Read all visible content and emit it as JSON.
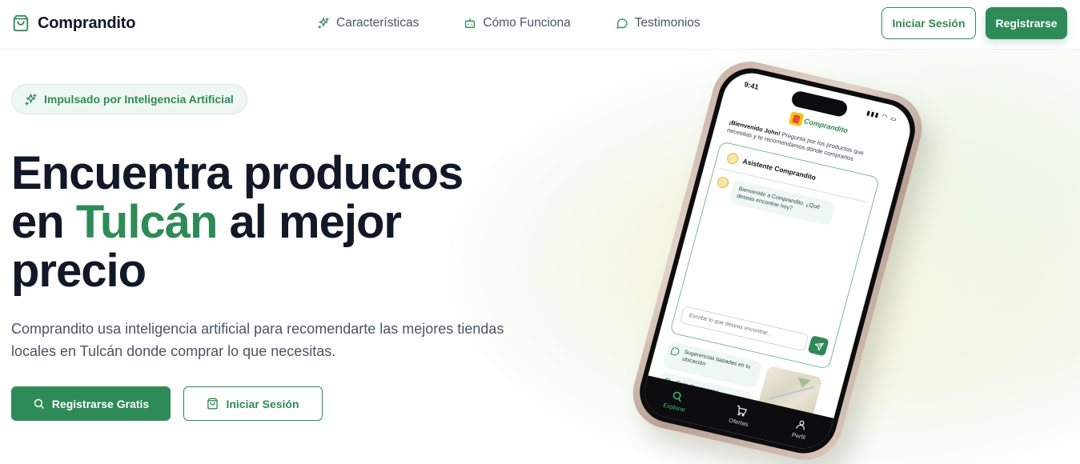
{
  "nav": {
    "brand": "Comprandito",
    "links": [
      {
        "label": "Características",
        "icon": "sparkles-icon"
      },
      {
        "label": "Cómo Funciona",
        "icon": "bot-icon"
      },
      {
        "label": "Testimonios",
        "icon": "message-circle-icon"
      }
    ],
    "login_label": "Iniciar Sesión",
    "register_label": "Registrarse"
  },
  "hero": {
    "badge": "Impulsado por Inteligencia Artificial",
    "headline_part1": "Encuentra productos en ",
    "headline_accent": "Tulcán",
    "headline_part2": " al mejor precio",
    "subtext": "Comprandito usa inteligencia artificial para recomendarte las mejores tiendas locales en Tulcán donde comprar lo que necesitas.",
    "cta_primary": "Registrarse Gratis",
    "cta_secondary": "Iniciar Sesión"
  },
  "phone": {
    "time": "9:41",
    "logo_text": "Comprandito",
    "welcome_bold": "¡Bienvenido John!",
    "welcome_rest": " Pregunta por los productos que necesitas y te recomendamos dónde comprarlos",
    "chat_title": "Asistente Comprandito",
    "bot_message": "Bienvenido a Comprandito. ¿Qué deseas encontrar hoy?",
    "input_placeholder": "Escribe lo que deseas encontrar...",
    "suggestion_1": "Sugerencias basadas en tu ubicación",
    "suggestion_2": "Guía de negocios",
    "tabs": [
      {
        "label": "Explorar",
        "icon": "search-icon",
        "active": true
      },
      {
        "label": "Ofertas",
        "icon": "cart-icon",
        "active": false
      },
      {
        "label": "Perfil",
        "icon": "user-icon",
        "active": false
      }
    ]
  },
  "colors": {
    "brand_green": "#2e8b57",
    "text_dark": "#111827",
    "text_muted": "#4b5563"
  }
}
